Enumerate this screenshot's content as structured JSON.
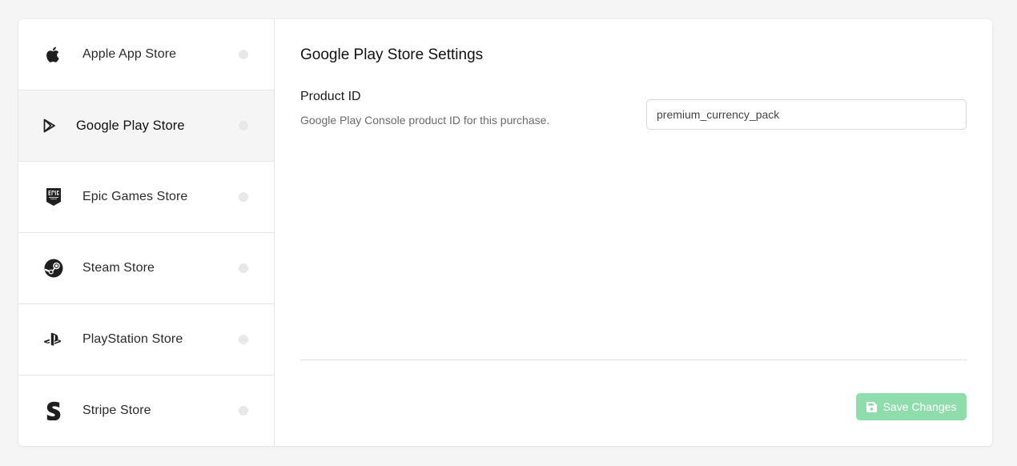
{
  "sidebar": {
    "items": [
      {
        "label": "Apple App Store",
        "icon": "apple-icon"
      },
      {
        "label": "Google Play Store",
        "icon": "google-play-icon",
        "active": true
      },
      {
        "label": "Epic Games Store",
        "icon": "epic-games-icon"
      },
      {
        "label": "Steam Store",
        "icon": "steam-icon"
      },
      {
        "label": "PlayStation Store",
        "icon": "playstation-icon"
      },
      {
        "label": "Stripe Store",
        "icon": "stripe-icon"
      }
    ]
  },
  "main": {
    "title": "Google Play Store Settings",
    "product_field": {
      "label": "Product ID",
      "description": "Google Play Console product ID for this purchase.",
      "value": "premium_currency_pack"
    },
    "save_label": "Save Changes"
  },
  "colors": {
    "save_button": "#8fdcac",
    "active_item_bg": "#f5f5f5",
    "status_dot": "#e8e8e8"
  }
}
